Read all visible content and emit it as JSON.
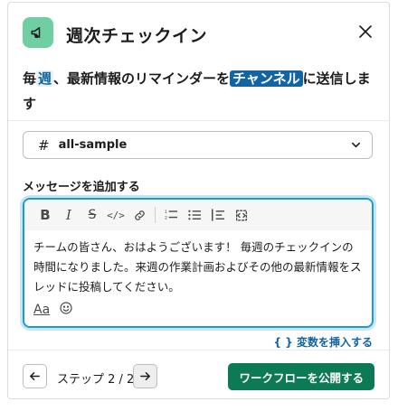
{
  "header": {
    "title": "週次チェックイン",
    "close_label": "×"
  },
  "summary": {
    "part1": "毎",
    "highlight_weekly": "週",
    "part2": "、最新情報のリマインダーを",
    "highlight_channel": "チャンネル",
    "part3": "に送信します"
  },
  "channel_select": {
    "hash": "#",
    "value": "all-sample"
  },
  "message_field": {
    "label": "メッセージを追加する",
    "text": "チームの皆さん、おはようございます！ 毎週のチェックインの時間になりました。来週の作業計画およびその他の最新情報をスレッドに投稿してください。",
    "aa_label": "Aa"
  },
  "insert_variable": "{ } 変数を挿入する",
  "footer": {
    "step_label": "ステップ 2 / 2",
    "publish_label": "ワークフローを公開する"
  },
  "colors": {
    "app_icon_bg": "#6fcfa3",
    "accent_blue": "#1264a3",
    "focus_border": "#1d9bd1",
    "publish_green": "#0b7a55"
  },
  "icons": {
    "app": "megaphone-icon",
    "close": "close-icon",
    "channel": "hash-icon",
    "dropdown": "chevron-down-icon",
    "toolbar": [
      "bold-icon",
      "italic-icon",
      "strikethrough-icon",
      "code-icon",
      "link-icon",
      "ordered-list-icon",
      "bulleted-list-icon",
      "blockquote-icon",
      "code-block-icon"
    ],
    "emoji": "emoji-icon",
    "prev": "arrow-left-icon",
    "next": "arrow-right-icon"
  }
}
